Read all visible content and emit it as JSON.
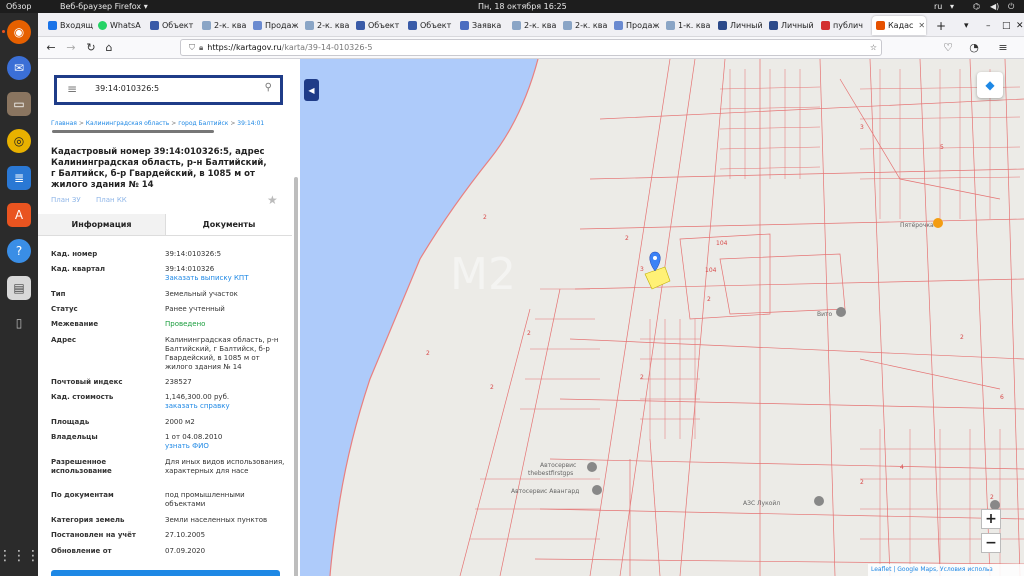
{
  "system": {
    "activities": "Обзор",
    "app_name": "Веб-браузер Firefox",
    "clock": "Пн, 18 октября  16:25",
    "lang": "ru"
  },
  "tabs": [
    {
      "label": "Входящ",
      "color": "#1a73e8"
    },
    {
      "label": "WhatsA",
      "color": "#25d366"
    },
    {
      "label": "Объект",
      "color": "#3a5ba8"
    },
    {
      "label": "2-к. ква",
      "color": "#8aa5c6"
    },
    {
      "label": "Продаж",
      "color": "#6a8ad0"
    },
    {
      "label": "2-к. ква",
      "color": "#8aa5c6"
    },
    {
      "label": "Объект",
      "color": "#3a5ba8"
    },
    {
      "label": "Объект",
      "color": "#3a5ba8"
    },
    {
      "label": "Заявка",
      "color": "#4a6cc0"
    },
    {
      "label": "2-к. ква",
      "color": "#8aa5c6"
    },
    {
      "label": "2-к. ква",
      "color": "#8aa5c6"
    },
    {
      "label": "Продаж",
      "color": "#6a8ad0"
    },
    {
      "label": "1-к. ква",
      "color": "#8aa5c6"
    },
    {
      "label": "Личный",
      "color": "#2c4a8a"
    },
    {
      "label": "Личный",
      "color": "#2c4a8a"
    },
    {
      "label": "публич",
      "color": "#d32f2f"
    },
    {
      "label": "Кадас",
      "color": "#e65100"
    }
  ],
  "browser": {
    "url_host": "https://kartagov.ru",
    "url_path": "/karta/39-14-010326-5"
  },
  "panel": {
    "search_value": "39:14:010326:5",
    "breadcrumb": [
      "Главная",
      ">",
      "Калининградская область",
      ">",
      "город Балтийск",
      ">",
      "39:14:01"
    ],
    "title": "Кадастровый номер 39:14:010326:5, адрес Калининградская область, р-н Балтийский, г Балтийск, б-р Гвардейский, в 1085 м от жилого здания № 14",
    "plan_zu": "План ЗУ",
    "plan_kk": "План КК",
    "tab_info": "Информация",
    "tab_docs": "Документы",
    "rows": [
      {
        "k": "Кад. номер",
        "v": "39:14:010326:5"
      },
      {
        "k": "Кад. квартал",
        "v": "39:14:010326",
        "link": "Заказать выписку КПТ"
      },
      {
        "k": "Тип",
        "v": "Земельный участок"
      },
      {
        "k": "Статус",
        "v": "Ранее учтенный"
      },
      {
        "k": "Межевание",
        "v": "Проведено"
      },
      {
        "k": "Адрес",
        "v": "Калининградская область, р-н Балтийский, г Балтийск, б-р Гвардейский, в 1085 м от жилого здания № 14"
      },
      {
        "k": "Почтовый индекс",
        "v": "238527"
      },
      {
        "k": "Кад. стоимость",
        "v": "1,146,300.00 руб.",
        "link": "заказать справку"
      },
      {
        "k": "Площадь",
        "v": "2000 м2"
      },
      {
        "k": "Владельцы",
        "v": "1 от 04.08.2010",
        "link": "узнать ФИО"
      },
      {
        "k": "Разрешенное использование",
        "v": "Для иных видов использования, характерных для насе"
      },
      {
        "k": "По документам",
        "v": "под промышленными объектами"
      },
      {
        "k": "Категория земель",
        "v": "Земли населенных пунктов"
      },
      {
        "k": "Постановлен на учёт",
        "v": "27.10.2005"
      },
      {
        "k": "Обновление от",
        "v": "07.09.2020"
      }
    ]
  },
  "map": {
    "labels": {
      "autoservice1": "Автосервис",
      "autoservice1b": "thebestfirstgps",
      "autoservice2": "Автосервис Авангард",
      "azs": "АЗС Лукойл",
      "pyaterochka": "Пятёрочка",
      "vito": "Вито",
      "watermark": "М2",
      "attribution": "Leaflet | Google Maps, Условия использ"
    },
    "parcel_numbers": [
      "2",
      "3",
      "2",
      "104",
      "104",
      "2",
      "2",
      "2",
      "2",
      "2",
      "2",
      "3",
      "5",
      "4",
      "2",
      "2",
      "6"
    ],
    "zoom_in": "+",
    "zoom_out": "−"
  }
}
